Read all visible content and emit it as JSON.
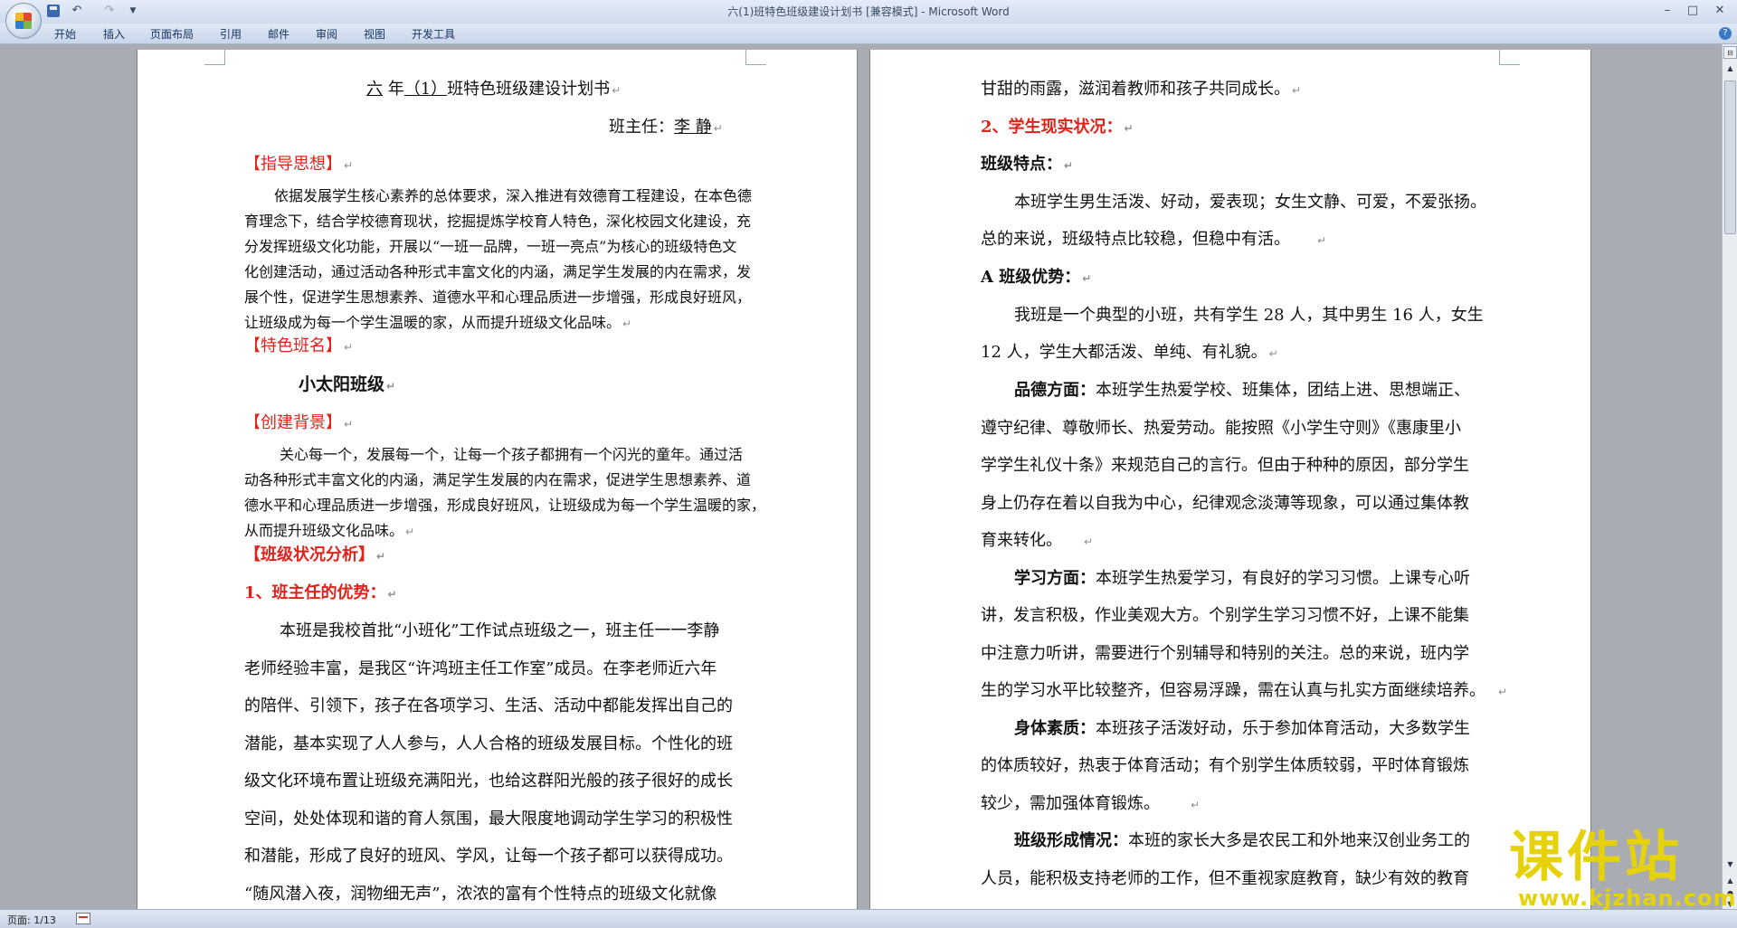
{
  "window": {
    "title": "六(1)班特色班级建设计划书 [兼容模式] - Microsoft Word",
    "undo_icon": "↶",
    "redo_icon": "↷",
    "qat_more": "▼",
    "minimize": "–",
    "maximize": "□",
    "close": "✕"
  },
  "ribbon": {
    "tabs": [
      "开始",
      "插入",
      "页面布局",
      "引用",
      "邮件",
      "审阅",
      "视图",
      "开发工具"
    ],
    "help": "?"
  },
  "marks": {
    "paragraph": "↵"
  },
  "left_page": {
    "title_pre": "六",
    "title_mid": "年",
    "title_class": "（1）",
    "title_rest": "班特色班级建设计划书",
    "teacher_label": "班主任：",
    "teacher_name": "李  静",
    "heading_guide": "【指导思想】",
    "guide_lines": [
      "依据发展学生核心素养的总体要求，深入推进有效德育工程建设，在本色德",
      "育理念下，结合学校德育现状，挖掘提炼学校育人特色，深化校园文化建设，充",
      "分发挥班级文化功能，开展以“一班一品牌，一班一亮点”为核心的班级特色文",
      "化创建活动，通过活动各种形式丰富文化的内涵，满足学生发展的内在需求，发",
      "展个性，促进学生思想素养、道德水平和心理品质进一步增强，形成良好班风，",
      "让班级成为每一个学生温暖的家，从而提升班级文化品味。"
    ],
    "heading_name": "【特色班名】",
    "class_name": "小太阳班级",
    "heading_background": "【创建背景】",
    "background_lines": [
      "关心每一个，发展每一个，让每一个孩子都拥有一个闪光的童年。通过活",
      "动各种形式丰富文化的内涵，满足学生发展的内在需求，促进学生思想素养、道",
      "德水平和心理品质进一步增强，形成良好班风，让班级成为每一个学生温暖的家，",
      "从而提升班级文化品味。"
    ],
    "heading_analysis": "【班级状况分析】",
    "sub_teacher": "1、班主任的优势：",
    "teacher_lines": [
      "本班是我校首批“小班化”工作试点班级之一，班主任一一李静",
      "老师经验丰富，是我区“许鸿班主任工作室”成员。在李老师近六年",
      "的陪伴、引领下，孩子在各项学习、生活、活动中都能发挥出自己的",
      "潜能，基本实现了人人参与，人人合格的班级发展目标。个性化的班",
      "级文化环境布置让班级充满阳光，也给这群阳光般的孩子很好的成长",
      "空间，处处体现和谐的育人氛围，最大限度地调动学生学习的积极性",
      "和潜能，形成了良好的班风、学风，让每一个孩子都可以获得成功。",
      "“随风潜入夜，润物细无声”，浓浓的富有个性特点的班级文化就像"
    ]
  },
  "right_page": {
    "first_line": "甘甜的雨露，滋润着教师和孩子共同成长。",
    "sub_students": "2、学生现实状况：",
    "h_features": "班级特点：",
    "features_lines": [
      "本班学生男生活泼、好动，爱表现；女生文静、可爱，不爱张扬。",
      "总的来说，班级特点比较稳，但稳中有活。"
    ],
    "h_advantage": "A 班级优势：",
    "advantage_lines": [
      "我班是一个典型的小班，共有学生 28 人，其中男生 16 人，女生",
      "12 人，学生大都活泼、单纯、有礼貌。"
    ],
    "moral_label": "品德方面：",
    "moral_lines": [
      "本班学生热爱学校、班集体，团结上进、思想端正、",
      "遵守纪律、尊敬师长、热爱劳动。能按照《小学生守则》《惠康里小",
      "学学生礼仪十条》来规范自己的言行。但由于种种的原因，部分学生",
      "身上仍存在着以自我为中心，纪律观念淡薄等现象，可以通过集体教",
      "育来转化。"
    ],
    "study_label": "学习方面：",
    "study_lines": [
      "本班学生热爱学习，有良好的学习习惯。上课专心听",
      "讲，发言积极，作业美观大方。个别学生学习习惯不好，上课不能集",
      "中注意力听讲，需要进行个别辅导和特别的关注。总的来说，班内学",
      "生的学习水平比较整齐，但容易浮躁，需在认真与扎实方面继续培养。"
    ],
    "body_label": "身体素质：",
    "body_lines": [
      "本班孩子活泼好动，乐于参加体育活动，大多数学生",
      "的体质较好，热衷于体育活动；有个别学生体质较弱，平时体育锻炼",
      "较少，需加强体育锻炼。"
    ],
    "form_label": "班级形成情况：",
    "form_lines": [
      "本班的家长大多是农民工和外地来汉创业务工的",
      "人员，能积极支持老师的工作，但不重视家庭教育，缺少有效的教育"
    ]
  },
  "status": {
    "page": "页面: 1/13"
  },
  "watermark": {
    "title": "课件站",
    "url": "www.kjzhan.com"
  },
  "scroll": {
    "ruler": "⊟",
    "up": "▲",
    "down": "▼",
    "prev": "▲",
    "browse": "●",
    "next": "▼"
  }
}
